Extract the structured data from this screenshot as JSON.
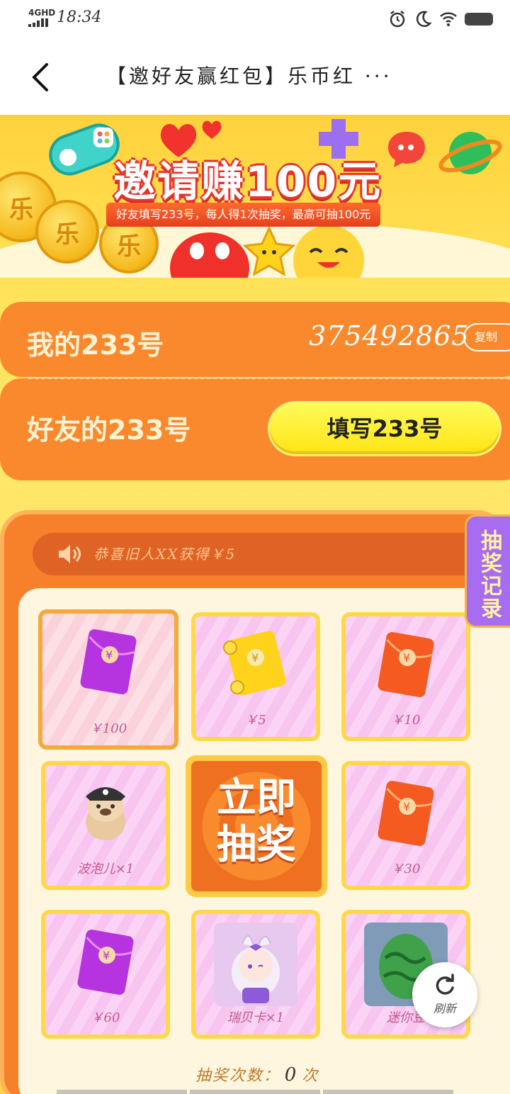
{
  "status_bar": {
    "network": "4GHD",
    "time": "18:34",
    "icons": [
      "alarm-icon",
      "moon-icon",
      "wifi-icon",
      "battery-icon"
    ]
  },
  "header": {
    "title": "【邀好友赢红包】乐币红 ···"
  },
  "banner": {
    "title": "邀请赚100元",
    "subtitle": "好友填写233号，每人得1次抽奖，最高可抽100元",
    "coin_text": "乐"
  },
  "id_card": {
    "my_label": "我的233号",
    "my_value": "375492865",
    "copy_label": "复制",
    "friend_label": "好友的233号",
    "fill_button": "填写233号"
  },
  "lottery": {
    "notice": "恭喜旧人XX获得￥5",
    "records_tab": "抽奖记录",
    "draw_button_line1": "立即",
    "draw_button_line2": "抽奖",
    "prizes": [
      {
        "label": "￥100",
        "type": "purple-envelope"
      },
      {
        "label": "￥5",
        "type": "yellow-envelope"
      },
      {
        "label": "￥10",
        "type": "orange-envelope"
      },
      {
        "label": "波泡儿×1",
        "type": "bear-character"
      },
      {
        "label": "￥30",
        "type": "orange-envelope"
      },
      {
        "label": "￥60",
        "type": "purple-envelope"
      },
      {
        "label": "瑞贝卡×1",
        "type": "girl-character"
      },
      {
        "label": "迷你豆",
        "type": "green-egg"
      }
    ],
    "count_prefix": "抽奖次数：",
    "count_value": "0",
    "count_suffix": "次"
  },
  "refresh": {
    "label": "刷新"
  },
  "colors": {
    "orange": "#f9892c",
    "yellow": "#ffe414",
    "purple": "#a86cf0",
    "pink": "#fbd4f5"
  }
}
